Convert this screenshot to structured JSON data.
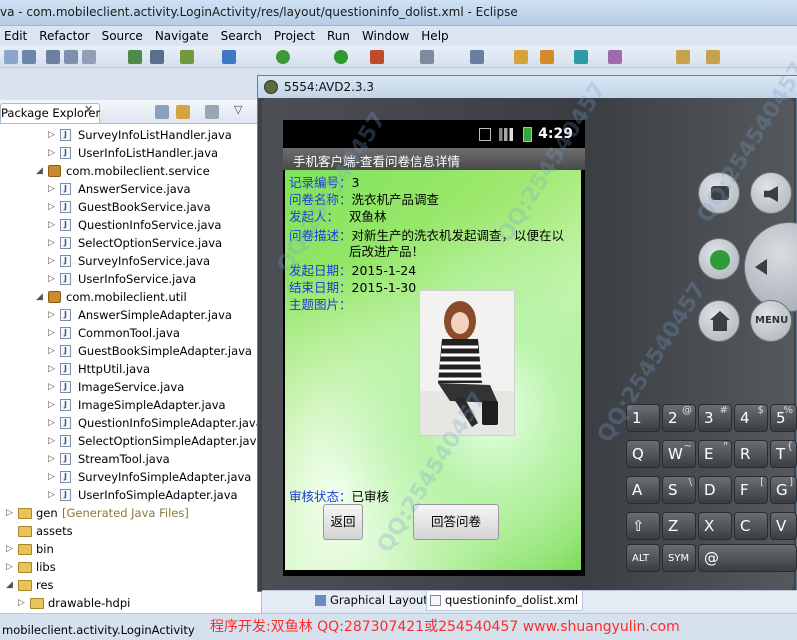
{
  "window": {
    "title": "va - com.mobileclient.activity.LoginActivity/res/layout/questioninfo_dolist.xml - Eclipse"
  },
  "menu": [
    "Edit",
    "Refactor",
    "Source",
    "Navigate",
    "Search",
    "Project",
    "Run",
    "Window",
    "Help"
  ],
  "explorer": {
    "tab_label": "Package Explorer",
    "close_glyph": "✕",
    "rows": [
      {
        "label": "SurveyInfoListHandler.java",
        "kind": "java",
        "indent": 3,
        "expand": "▷"
      },
      {
        "label": "UserInfoListHandler.java",
        "kind": "java",
        "indent": 3,
        "expand": "▷"
      },
      {
        "label": "com.mobileclient.service",
        "kind": "package",
        "indent": 2,
        "expand": "◢"
      },
      {
        "label": "AnswerService.java",
        "kind": "java",
        "indent": 3,
        "expand": "▷"
      },
      {
        "label": "GuestBookService.java",
        "kind": "java",
        "indent": 3,
        "expand": "▷"
      },
      {
        "label": "QuestionInfoService.java",
        "kind": "java",
        "indent": 3,
        "expand": "▷"
      },
      {
        "label": "SelectOptionService.java",
        "kind": "java",
        "indent": 3,
        "expand": "▷"
      },
      {
        "label": "SurveyInfoService.java",
        "kind": "java",
        "indent": 3,
        "expand": "▷"
      },
      {
        "label": "UserInfoService.java",
        "kind": "java",
        "indent": 3,
        "expand": "▷"
      },
      {
        "label": "com.mobileclient.util",
        "kind": "package",
        "indent": 2,
        "expand": "◢"
      },
      {
        "label": "AnswerSimpleAdapter.java",
        "kind": "java",
        "indent": 3,
        "expand": "▷"
      },
      {
        "label": "CommonTool.java",
        "kind": "java",
        "indent": 3,
        "expand": "▷"
      },
      {
        "label": "GuestBookSimpleAdapter.java",
        "kind": "java",
        "indent": 3,
        "expand": "▷"
      },
      {
        "label": "HttpUtil.java",
        "kind": "java",
        "indent": 3,
        "expand": "▷"
      },
      {
        "label": "ImageService.java",
        "kind": "java",
        "indent": 3,
        "expand": "▷"
      },
      {
        "label": "ImageSimpleAdapter.java",
        "kind": "java",
        "indent": 3,
        "expand": "▷"
      },
      {
        "label": "QuestionInfoSimpleAdapter.java",
        "kind": "java",
        "indent": 3,
        "expand": "▷"
      },
      {
        "label": "SelectOptionSimpleAdapter.java",
        "kind": "java",
        "indent": 3,
        "expand": "▷"
      },
      {
        "label": "StreamTool.java",
        "kind": "java",
        "indent": 3,
        "expand": "▷"
      },
      {
        "label": "SurveyInfoSimpleAdapter.java",
        "kind": "java",
        "indent": 3,
        "expand": "▷"
      },
      {
        "label": "UserInfoSimpleAdapter.java",
        "kind": "java",
        "indent": 3,
        "expand": "▷"
      },
      {
        "label": "gen",
        "kind": "folder",
        "indent": 0,
        "expand": "▷",
        "suffix": "[Generated Java Files]"
      },
      {
        "label": "assets",
        "kind": "folder",
        "indent": 0,
        "expand": ""
      },
      {
        "label": "bin",
        "kind": "folder",
        "indent": 0,
        "expand": "▷"
      },
      {
        "label": "libs",
        "kind": "folder",
        "indent": 0,
        "expand": "▷"
      },
      {
        "label": "res",
        "kind": "folder",
        "indent": 0,
        "expand": "◢"
      },
      {
        "label": "drawable-hdpi",
        "kind": "folder",
        "indent": 1,
        "expand": "▷"
      }
    ]
  },
  "emulator": {
    "title": "5554:AVD2.3.3",
    "clock": "4:29",
    "app_title": "手机客户端-查看问卷信息详情",
    "fields": [
      {
        "label": "记录编号：",
        "value": "3"
      },
      {
        "label": "问卷名称：",
        "value": "洗衣机产品调查"
      },
      {
        "label": "发起人：",
        "value": "双鱼林"
      },
      {
        "label": "问卷描述：",
        "value": "对新生产的洗衣机发起调查，以便在以",
        "value2": "后改进产品！"
      },
      {
        "label": "发起日期：",
        "value": "2015-1-24"
      },
      {
        "label": "结束日期：",
        "value": "2015-1-30"
      },
      {
        "label": "主题图片：",
        "value": ""
      }
    ],
    "audit": {
      "label": "审核状态：",
      "value": "已审核"
    },
    "buttons": {
      "back": "返回",
      "answer": "回答问卷"
    },
    "hw": {
      "menu": "MENU",
      "alt": "ALT",
      "sym": "SYM",
      "at": "@"
    },
    "keys": [
      {
        "main": "1",
        "sub": ""
      },
      {
        "main": "2",
        "sub": "@"
      },
      {
        "main": "3",
        "sub": "#"
      },
      {
        "main": "4",
        "sub": "$"
      },
      {
        "main": "5",
        "sub": "%"
      },
      {
        "main": "Q",
        "sub": ""
      },
      {
        "main": "W",
        "sub": "~"
      },
      {
        "main": "E",
        "sub": "\""
      },
      {
        "main": "R",
        "sub": ""
      },
      {
        "main": "T",
        "sub": "{"
      },
      {
        "main": "A",
        "sub": ""
      },
      {
        "main": "S",
        "sub": "\\"
      },
      {
        "main": "D",
        "sub": ""
      },
      {
        "main": "F",
        "sub": "["
      },
      {
        "main": "G",
        "sub": "]"
      },
      {
        "main": "⇧",
        "sub": ""
      },
      {
        "main": "Z",
        "sub": ""
      },
      {
        "main": "X",
        "sub": ""
      },
      {
        "main": "C",
        "sub": ""
      },
      {
        "main": "V",
        "sub": ""
      }
    ]
  },
  "editor_tabs": [
    "Graphical Layout",
    "questioninfo_dolist.xml"
  ],
  "status": {
    "left": "mobileclient.activity.LoginActivity",
    "credit": "程序开发:双鱼林 QQ:287307421或254540457 www.shuangyulin.com"
  },
  "watermark": "QQ:254540457"
}
